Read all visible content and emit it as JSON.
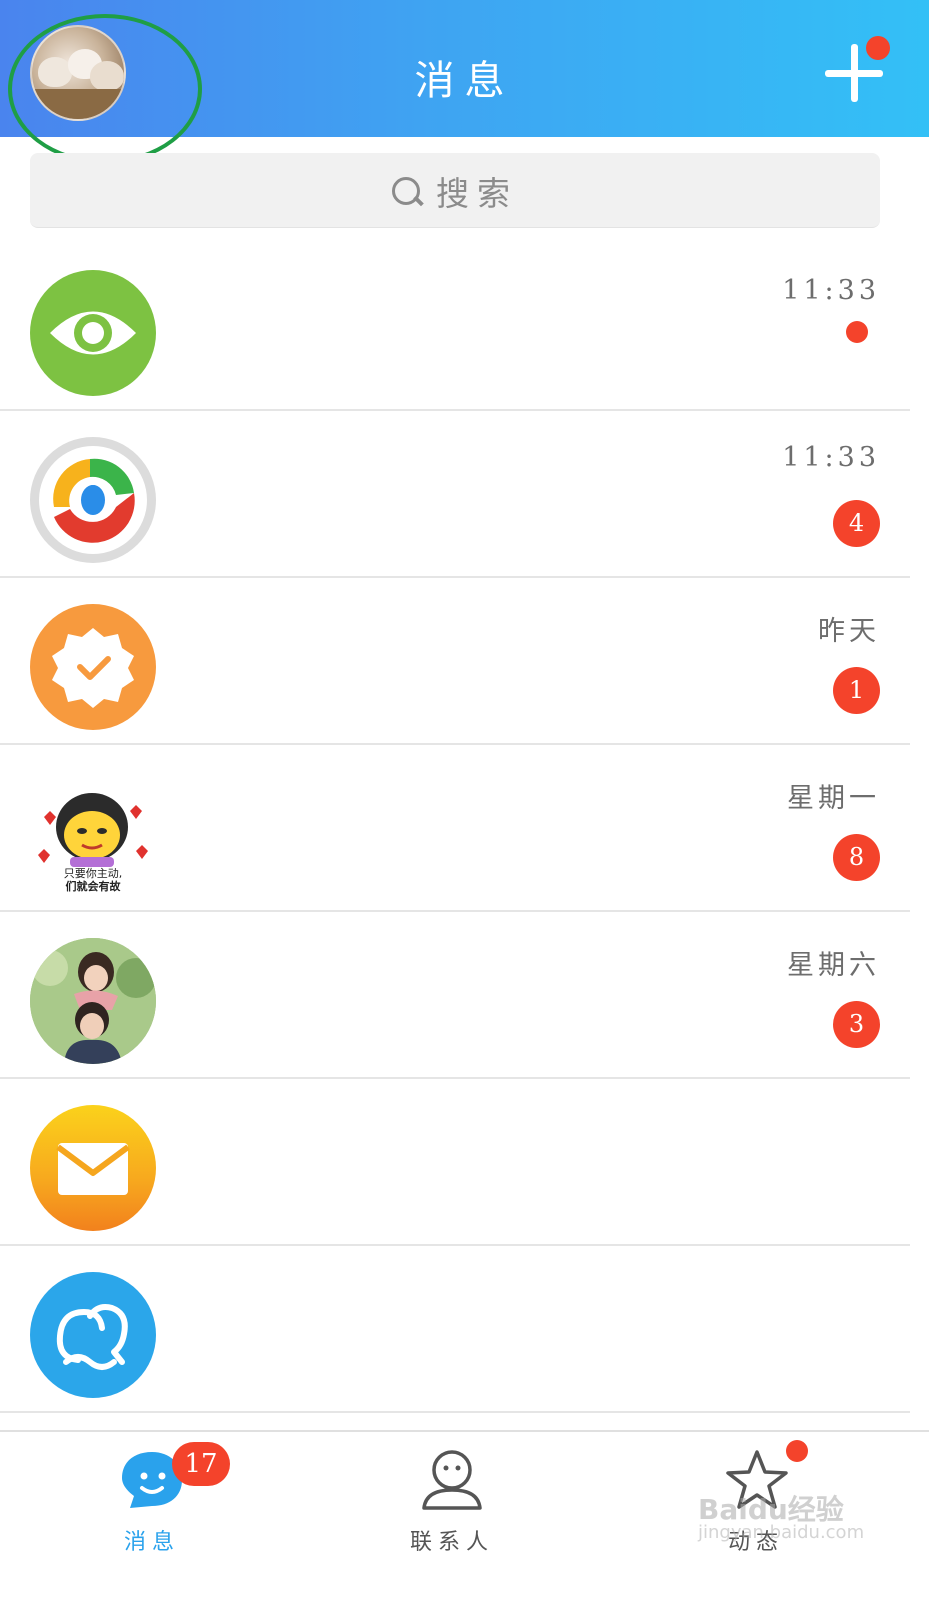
{
  "header": {
    "title": "消息",
    "profile_avatar": "profile-avatar-cats",
    "add_button_icon": "plus-icon",
    "add_button_badge": "red-dot",
    "colors": {
      "gradient_start": "#4a84ee",
      "gradient_end": "#33c0f6",
      "highlight_ring": "#1f9e45"
    }
  },
  "search": {
    "placeholder": "搜索",
    "icon": "search-icon"
  },
  "conversations": [
    {
      "avatar": "eye-icon",
      "avatar_color": "#7dc242",
      "time": "11:33",
      "unread_type": "dot",
      "unread": ""
    },
    {
      "avatar": "qq-news-icon",
      "avatar_color": "#dcdcdc",
      "time": "11:33",
      "unread_type": "count",
      "unread": "4"
    },
    {
      "avatar": "verified-badge-icon",
      "avatar_color": "#f79a3e",
      "time": "昨天",
      "unread_type": "count",
      "unread": "1"
    },
    {
      "avatar": "cartoon-sticker-avatar",
      "avatar_color": "#ffffff",
      "avatar_text": [
        "只要你主动,",
        "们就会有故"
      ],
      "time": "星期一",
      "unread_type": "count",
      "unread": "8"
    },
    {
      "avatar": "couple-photo-avatar",
      "avatar_color": "#9cc07a",
      "time": "星期六",
      "unread_type": "count",
      "unread": "3"
    },
    {
      "avatar": "mail-icon",
      "avatar_color": "#f7c21a",
      "time": "",
      "unread_type": "none",
      "unread": ""
    },
    {
      "avatar": "contacts-icon",
      "avatar_color": "#2ba6ea",
      "time": "",
      "unread_type": "none",
      "unread": ""
    }
  ],
  "tabbar": {
    "tabs": [
      {
        "label": "消息",
        "icon": "message-bubble-icon",
        "badge": "17",
        "active": true,
        "color": "#2aa2ec"
      },
      {
        "label": "联系人",
        "icon": "person-icon",
        "badge": "",
        "active": false,
        "color": "#555555"
      },
      {
        "label": "动态",
        "icon": "star-icon",
        "badge": "dot",
        "active": false,
        "color": "#555555"
      }
    ],
    "watermark": "Baidu经验",
    "watermark_sub": "jingyan.baidu.com"
  },
  "colors": {
    "badge": "#f4432b",
    "divider": "#e5e5e5",
    "accent": "#2aa2ec"
  }
}
